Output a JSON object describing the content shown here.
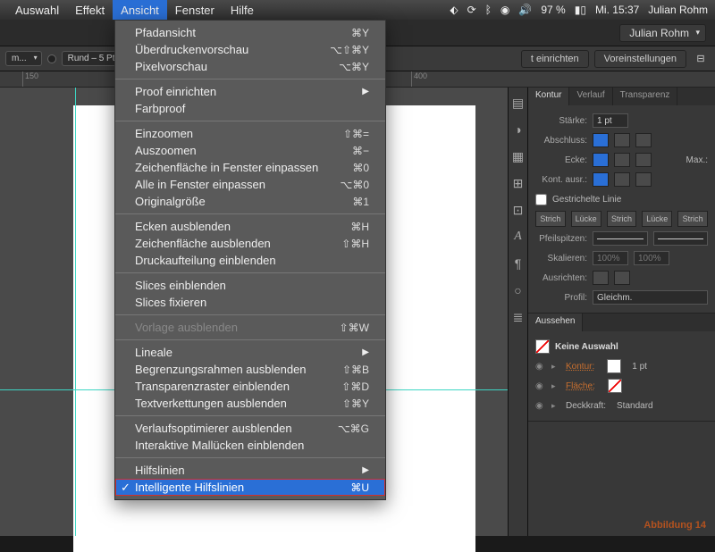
{
  "menubar": {
    "items": [
      "Auswahl",
      "Effekt",
      "Ansicht",
      "Fenster",
      "Hilfe"
    ],
    "active_index": 2,
    "status": {
      "battery": "97 %",
      "day_time": "Mi. 15:37",
      "user": "Julian Rohm"
    }
  },
  "app": {
    "user_button": "Julian Rohm"
  },
  "control_bar": {
    "chips": [
      "m...",
      "Rund – 5 Pt..."
    ],
    "buttons": [
      "t einrichten",
      "Voreinstellungen"
    ]
  },
  "ruler": {
    "ticks": [
      {
        "pos": 25,
        "label": "150"
      },
      {
        "pos": 460,
        "label": "400"
      }
    ]
  },
  "dropdown": {
    "groups": [
      [
        {
          "label": "Pfadansicht",
          "shortcut": "⌘Y"
        },
        {
          "label": "Überdruckenvorschau",
          "shortcut": "⌥⇧⌘Y"
        },
        {
          "label": "Pixelvorschau",
          "shortcut": "⌥⌘Y"
        }
      ],
      [
        {
          "label": "Proof einrichten",
          "submenu": true
        },
        {
          "label": "Farbproof"
        }
      ],
      [
        {
          "label": "Einzoomen",
          "shortcut": "⇧⌘="
        },
        {
          "label": "Auszoomen",
          "shortcut": "⌘−"
        },
        {
          "label": "Zeichenfläche in Fenster einpassen",
          "shortcut": "⌘0"
        },
        {
          "label": "Alle in Fenster einpassen",
          "shortcut": "⌥⌘0"
        },
        {
          "label": "Originalgröße",
          "shortcut": "⌘1"
        }
      ],
      [
        {
          "label": "Ecken ausblenden",
          "shortcut": "⌘H"
        },
        {
          "label": "Zeichenfläche ausblenden",
          "shortcut": "⇧⌘H"
        },
        {
          "label": "Druckaufteilung einblenden"
        }
      ],
      [
        {
          "label": "Slices einblenden"
        },
        {
          "label": "Slices fixieren"
        }
      ],
      [
        {
          "label": "Vorlage ausblenden",
          "shortcut": "⇧⌘W",
          "disabled": true
        }
      ],
      [
        {
          "label": "Lineale",
          "submenu": true
        },
        {
          "label": "Begrenzungsrahmen ausblenden",
          "shortcut": "⇧⌘B"
        },
        {
          "label": "Transparenzraster einblenden",
          "shortcut": "⇧⌘D"
        },
        {
          "label": "Textverkettungen ausblenden",
          "shortcut": "⇧⌘Y"
        }
      ],
      [
        {
          "label": "Verlaufsoptimierer ausblenden",
          "shortcut": "⌥⌘G"
        },
        {
          "label": "Interaktive Mallücken einblenden"
        }
      ],
      [
        {
          "label": "Hilfslinien",
          "submenu": true
        },
        {
          "label": "Intelligente Hilfslinien",
          "shortcut": "⌘U",
          "checked": true,
          "highlight": true
        }
      ]
    ]
  },
  "stroke_panel": {
    "tabs": [
      "Kontur",
      "Verlauf",
      "Transparenz"
    ],
    "weight_label": "Stärke:",
    "weight": "1 pt",
    "cap_label": "Abschluss:",
    "corner_label": "Ecke:",
    "max_label": "Max.:",
    "align_label": "Kont. ausr.:",
    "dashed_label": "Gestrichelte Linie",
    "dash_labels": [
      "Strich",
      "Lücke",
      "Strich",
      "Lücke",
      "Strich"
    ],
    "arrows_label": "Pfeilspitzen:",
    "scale_label": "Skalieren:",
    "scale1": "100%",
    "scale2": "100%",
    "align2_label": "Ausrichten:",
    "profile_label": "Profil:",
    "profile": "Gleichm."
  },
  "appearance_panel": {
    "title": "Aussehen",
    "no_selection": "Keine Auswahl",
    "rows": [
      {
        "label": "Kontur:",
        "value": "1 pt"
      },
      {
        "label": "Fläche:",
        "value": ""
      },
      {
        "label": "Deckkraft:",
        "value": "Standard",
        "plain": true
      }
    ]
  },
  "caption": "Abbildung 14"
}
